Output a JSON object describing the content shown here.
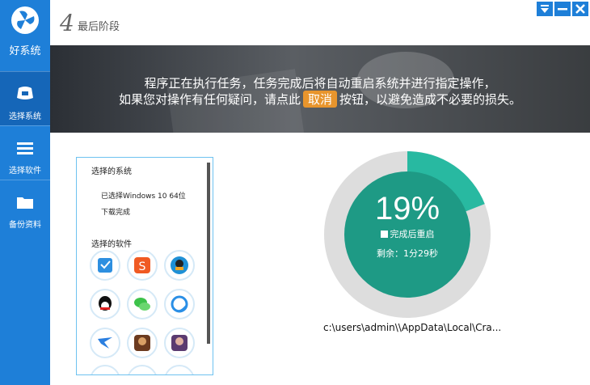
{
  "app": {
    "name": "好系统"
  },
  "sidebar": {
    "items": [
      {
        "label": "选择系统",
        "icon": "monitor-icon",
        "active": true
      },
      {
        "label": "选择软件",
        "icon": "menu-icon",
        "active": false
      },
      {
        "label": "备份资料",
        "icon": "folder-icon",
        "active": false
      }
    ]
  },
  "header": {
    "step_number": "4",
    "step_title": "最后阶段"
  },
  "window_controls": {
    "minimize_icon": "minimize-icon",
    "close_icon": "close-icon",
    "dropdown_icon": "chevron-down-icon"
  },
  "banner": {
    "line1": "程序正在执行任务，任务完成后将自动重启系统并进行指定操作，",
    "line2_before": "如果您对操作有任何疑问，请点此",
    "cancel_label": "取消",
    "line2_after": "按钮，以避免造成不必要的损失。"
  },
  "panel": {
    "system_header": "选择的系统",
    "selected_system": "已选择Windows 10 64位",
    "download_status": "下载完成",
    "software_header": "选择的软件",
    "apps": [
      {
        "icon": "shield-app-icon",
        "color": "#2d8fe0"
      },
      {
        "icon": "sogou-app-icon",
        "color": "#f05a23"
      },
      {
        "icon": "penguin-manager-icon",
        "color": "#1e90d6"
      },
      {
        "icon": "qq-icon",
        "color": "#111111"
      },
      {
        "icon": "wechat-icon",
        "color": "#3dc24a"
      },
      {
        "icon": "browser-icon",
        "color": "#2a8fe6"
      },
      {
        "icon": "thunder-icon",
        "color": "#2b7fe0"
      },
      {
        "icon": "game-icon-1",
        "color": "#6b3a1f"
      },
      {
        "icon": "game-icon-2",
        "color": "#5a3a70"
      }
    ]
  },
  "progress": {
    "percent_label": "19%",
    "percent": 19,
    "restart_label": "完成后重启",
    "remaining_label": "剩余：1分29秒",
    "track_color": "#dddddd",
    "fill_color": "#28b9a1",
    "inner_color": "#1e9a85"
  },
  "status": {
    "path": "c:\\users\\admin\\\\AppData\\Local\\Cra..."
  }
}
